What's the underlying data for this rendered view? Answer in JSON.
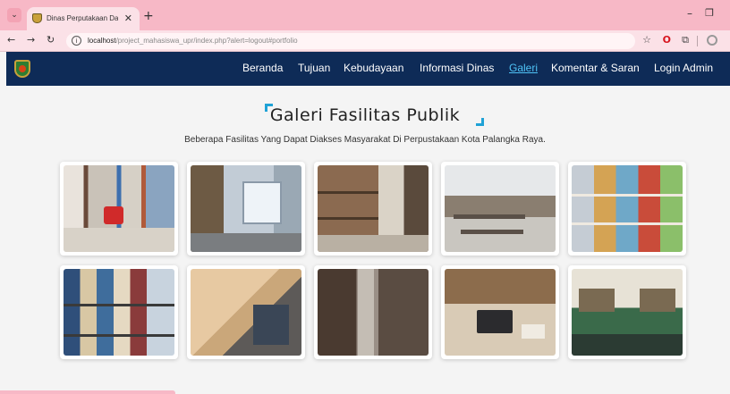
{
  "browser": {
    "tab_title": "Dinas Perputakaan Dan Arsip K",
    "new_tab_label": "+",
    "address_host": "localhost",
    "address_path": "/project_mahasiswa_upr/index.php?alert=logout#portfolio"
  },
  "navbar": {
    "links": [
      "Beranda",
      "Tujuan",
      "Kebudayaan",
      "Informasi Dinas",
      "Galeri",
      "Komentar & Saran",
      "Login Admin"
    ],
    "active": "Galeri"
  },
  "gallery": {
    "title": "Galeri Fasilitas Publik",
    "subtitle": "Beberapa Fasilitas Yang Dapat Diakses Masyarakat Di Perpustakaan Kota Palangka Raya.",
    "photos": [
      "library-aisle-red-chair",
      "library-reading-room-windows",
      "library-bookshelves-corner",
      "library-hall-tables",
      "library-colorful-shelves",
      "library-shelves-closeup",
      "library-study-desk",
      "library-narrow-aisle",
      "library-laptop-desk",
      "library-green-shelves-room"
    ]
  },
  "colors": {
    "navbar_bg": "#0e2b57",
    "accent": "#1fa2d6",
    "browser_chrome": "#f7b8c6"
  },
  "icons": [
    "tab-menu-icon",
    "back-icon",
    "forward-icon",
    "reload-icon",
    "info-icon",
    "star-icon",
    "opera-icon",
    "extensions-icon",
    "profile-icon",
    "minimize-icon",
    "maximize-icon",
    "close-icon"
  ]
}
